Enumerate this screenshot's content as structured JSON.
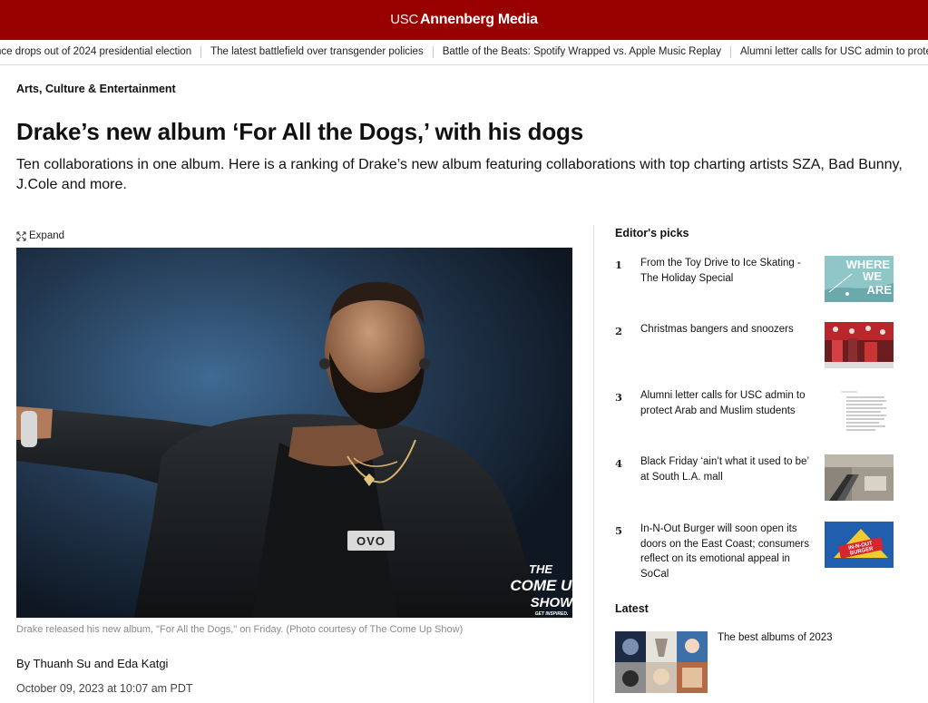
{
  "header": {
    "logo_usc": "USC",
    "logo_brand": "Annenberg Media",
    "brand_color": "#990000"
  },
  "ticker": {
    "items": [
      "nce drops out of 2024 presidential election",
      "The latest battlefield over transgender policies",
      "Battle of the Beats: Spotify Wrapped vs. Apple Music Replay",
      "Alumni letter calls for USC admin to protect"
    ]
  },
  "article": {
    "section": "Arts, Culture & Entertainment",
    "headline": "Drake’s new album ‘For All the Dogs,’ with his dogs",
    "dek": "Ten collaborations in one album. Here is a ranking of Drake’s new album featuring collaborations with top charting artists SZA, Bad Bunny, J.Cole and more.",
    "expand_label": "Expand",
    "photo_watermark": [
      "THE",
      "COME UP",
      "SHOW",
      "GET INSPIRED."
    ],
    "photo_shirt_logo": "OVO",
    "caption": "Drake released his new album, \"For All the Dogs,\" on Friday. (Photo courtesy of The Come Up Show)",
    "byline": "By Thuanh Su and Eda Katgi",
    "date": "October 09, 2023 at 10:07 am PDT"
  },
  "editors_picks": {
    "title": "Editor's picks",
    "items": [
      {
        "num": "1",
        "title": "From the Toy Drive to Ice Skating - The Holiday Special",
        "thumb_text": [
          "WHERE",
          "WE",
          "ARE"
        ]
      },
      {
        "num": "2",
        "title": "Christmas bangers and snoozers"
      },
      {
        "num": "3",
        "title": "Alumni letter calls for USC admin to protect Arab and Muslim students"
      },
      {
        "num": "4",
        "title": "Black Friday ‘ain’t what it used to be’ at South L.A. mall"
      },
      {
        "num": "5",
        "title": "In-N-Out Burger will soon open its doors on the East Coast; consumers reflect on its emotional appeal in SoCal",
        "thumb_text": [
          "IN-N-OUT",
          "BURGER"
        ]
      }
    ]
  },
  "latest": {
    "title": "Latest",
    "items": [
      {
        "title": "The best albums of 2023"
      }
    ]
  }
}
